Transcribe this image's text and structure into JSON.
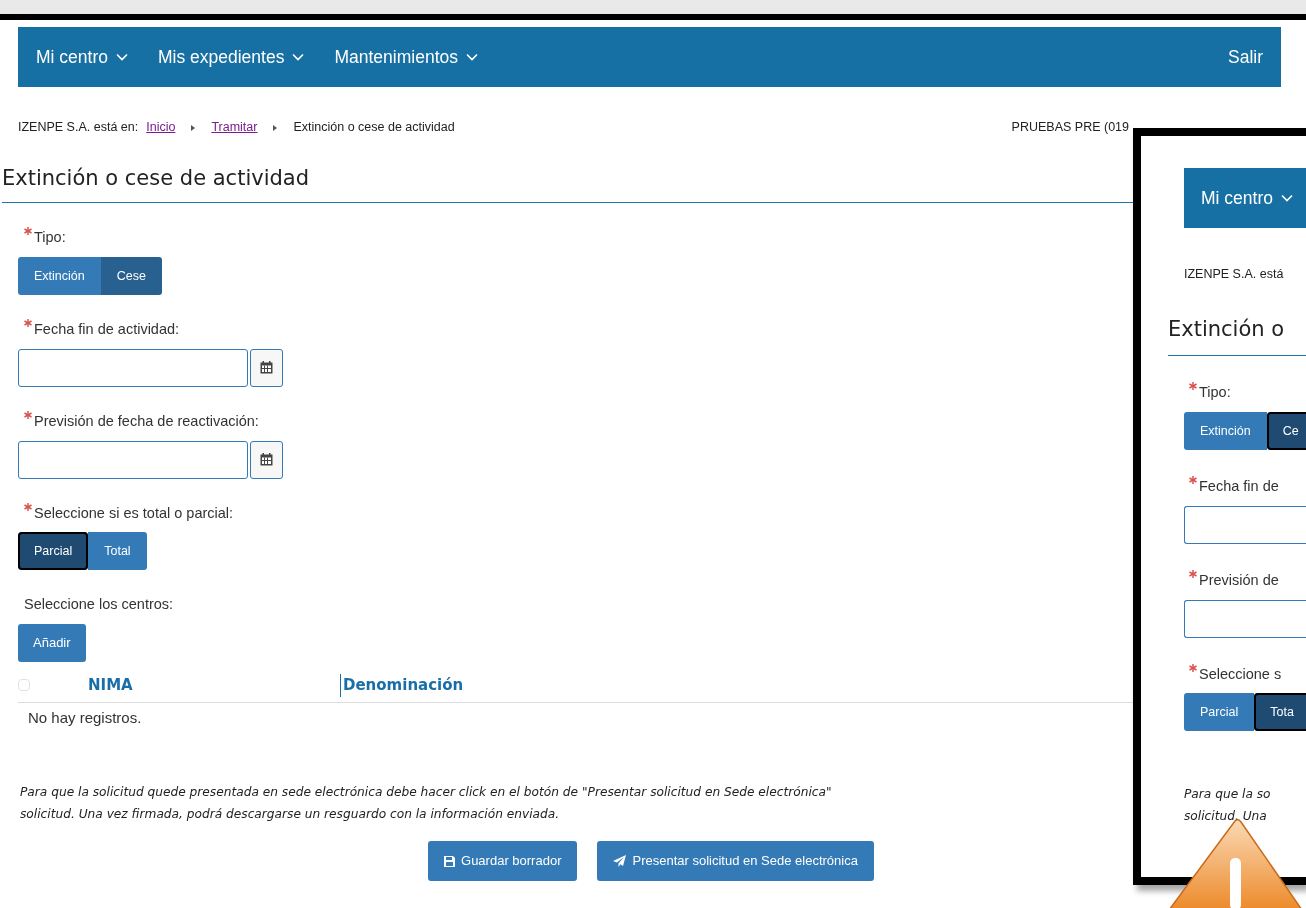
{
  "navbar": {
    "menus": [
      {
        "label": "Mi centro"
      },
      {
        "label": "Mis expedientes"
      },
      {
        "label": "Mantenimientos"
      }
    ],
    "logout": "Salir"
  },
  "breadcrumb": {
    "prefix": "IZENPE S.A. está en:",
    "items": [
      {
        "label": "Inicio",
        "kind": "link"
      },
      {
        "label": "Tramitar",
        "kind": "link"
      },
      {
        "label": "Extinción o cese de actividad",
        "kind": "current"
      }
    ]
  },
  "account": "PRUEBAS PRE (019",
  "title": "Extinción o cese de actividad",
  "fields": [
    {
      "kind": "toggle",
      "label": "Tipo:",
      "required": true,
      "options": [
        {
          "label": "Extinción",
          "selected": false
        },
        {
          "label": "Cese",
          "selected": true
        }
      ]
    },
    {
      "kind": "date",
      "label": "Fecha fin de actividad:",
      "required": true
    },
    {
      "kind": "date",
      "label": "Previsión de fecha de reactivación:",
      "required": true
    },
    {
      "kind": "toggle",
      "label": "Seleccione si es total o parcial:",
      "required": true,
      "options": [
        {
          "label": "Parcial",
          "selected": true
        },
        {
          "label": "Total",
          "selected": false
        }
      ]
    },
    {
      "kind": "add",
      "label": "Seleccione los centros:",
      "required": false,
      "button": "Añadir"
    }
  ],
  "table": {
    "select_all_checked": false,
    "columns": [
      "NIMA",
      "Denominación"
    ],
    "empty": "No hay registros."
  },
  "notice": [
    "Para que la solicitud quede presentada en sede electrónica debe hacer click en el botón de \"Presentar solicitud en Sede electrónica\"",
    "solicitud. Una vez firmada, podrá descargarse un resguardo con la información enviada."
  ],
  "actions": [
    {
      "label": "Guardar borrador"
    },
    {
      "label": "Presentar solicitud en Sede electrónica"
    }
  ],
  "overlay": {
    "menu": "Mi centro",
    "breadcrumb": "IZENPE S.A. está",
    "title": "Extinción o",
    "fields": [
      {
        "kind": "toggle",
        "label": "Tipo:",
        "required": true,
        "options": [
          {
            "label": "Extinción",
            "selected": false
          },
          {
            "label": "Ce",
            "selected": true
          }
        ]
      },
      {
        "kind": "date",
        "label": "Fecha fin de",
        "required": true
      },
      {
        "kind": "date",
        "label": "Previsión de",
        "required": true
      },
      {
        "kind": "toggle",
        "label": "Seleccione s",
        "required": true,
        "options": [
          {
            "label": "Parcial",
            "selected": false
          },
          {
            "label": "Tota",
            "selected": true
          }
        ]
      }
    ],
    "notice": [
      "Para que la so",
      "solicitud. Una"
    ]
  }
}
